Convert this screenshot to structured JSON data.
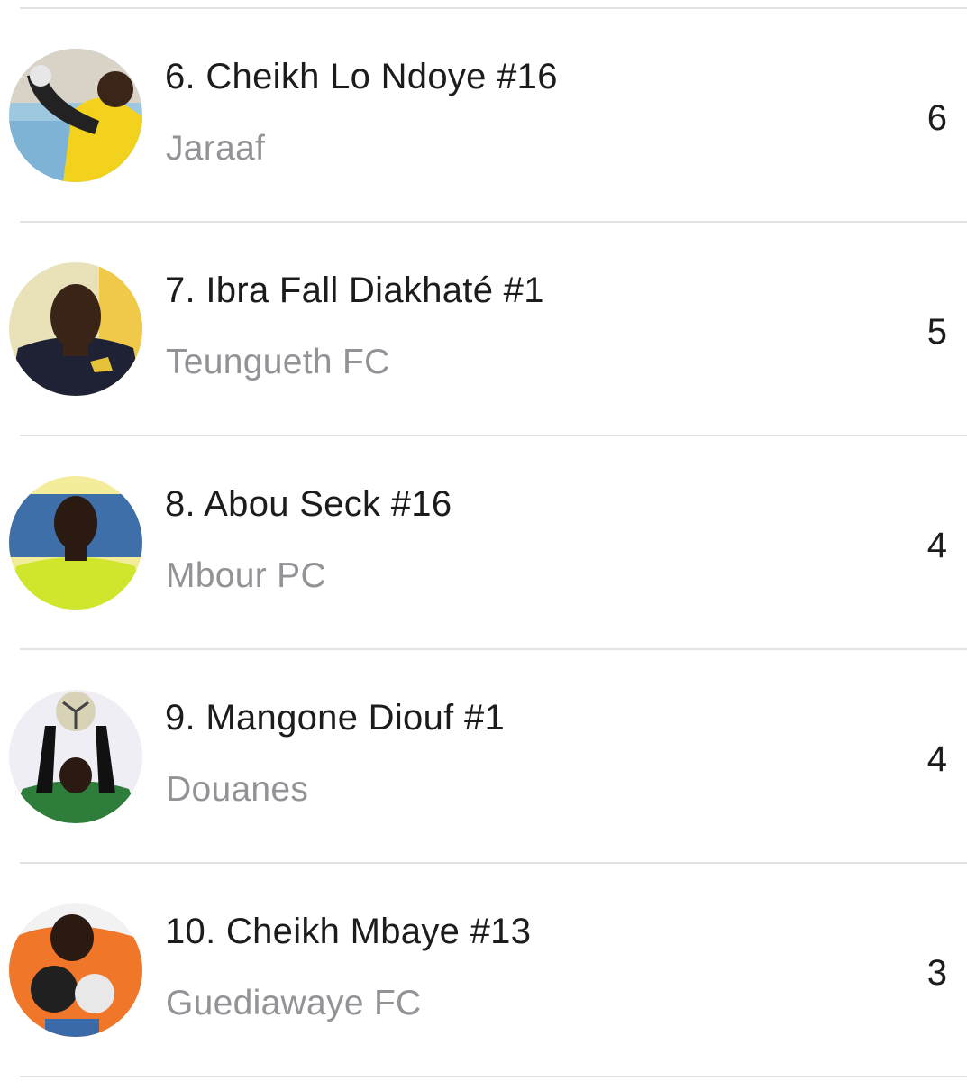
{
  "players": [
    {
      "rank_name": "6. Cheikh Lo Ndoye #16",
      "team": "Jaraaf",
      "value": "6"
    },
    {
      "rank_name": "7. Ibra Fall Diakhaté #1",
      "team": "Teungueth FC",
      "value": "5"
    },
    {
      "rank_name": "8. Abou Seck #16",
      "team": "Mbour PC",
      "value": "4"
    },
    {
      "rank_name": "9. Mangone Diouf #1",
      "team": "Douanes",
      "value": "4"
    },
    {
      "rank_name": "10. Cheikh Mbaye #13",
      "team": "Guediawaye FC",
      "value": "3"
    }
  ],
  "colors": {
    "name_text": "#1c1c1e",
    "team_text": "#929297",
    "divider": "#e2e2e4",
    "background": "#ffffff"
  }
}
